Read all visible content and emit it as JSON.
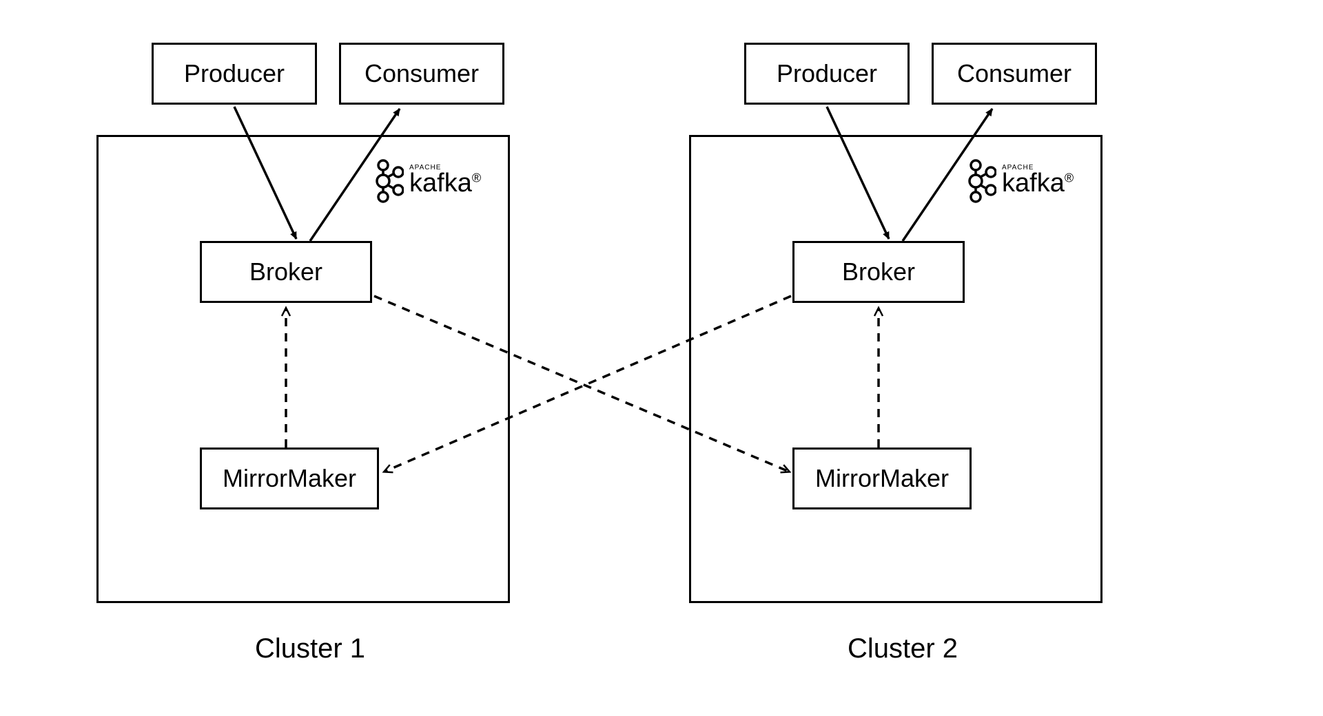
{
  "clusters": [
    {
      "label": "Cluster 1",
      "producer": "Producer",
      "consumer": "Consumer",
      "broker": "Broker",
      "mirror": "MirrorMaker",
      "kafka_small": "APACHE",
      "kafka_text": "kafka"
    },
    {
      "label": "Cluster 2",
      "producer": "Producer",
      "consumer": "Consumer",
      "broker": "Broker",
      "mirror": "MirrorMaker",
      "kafka_small": "APACHE",
      "kafka_text": "kafka"
    }
  ]
}
